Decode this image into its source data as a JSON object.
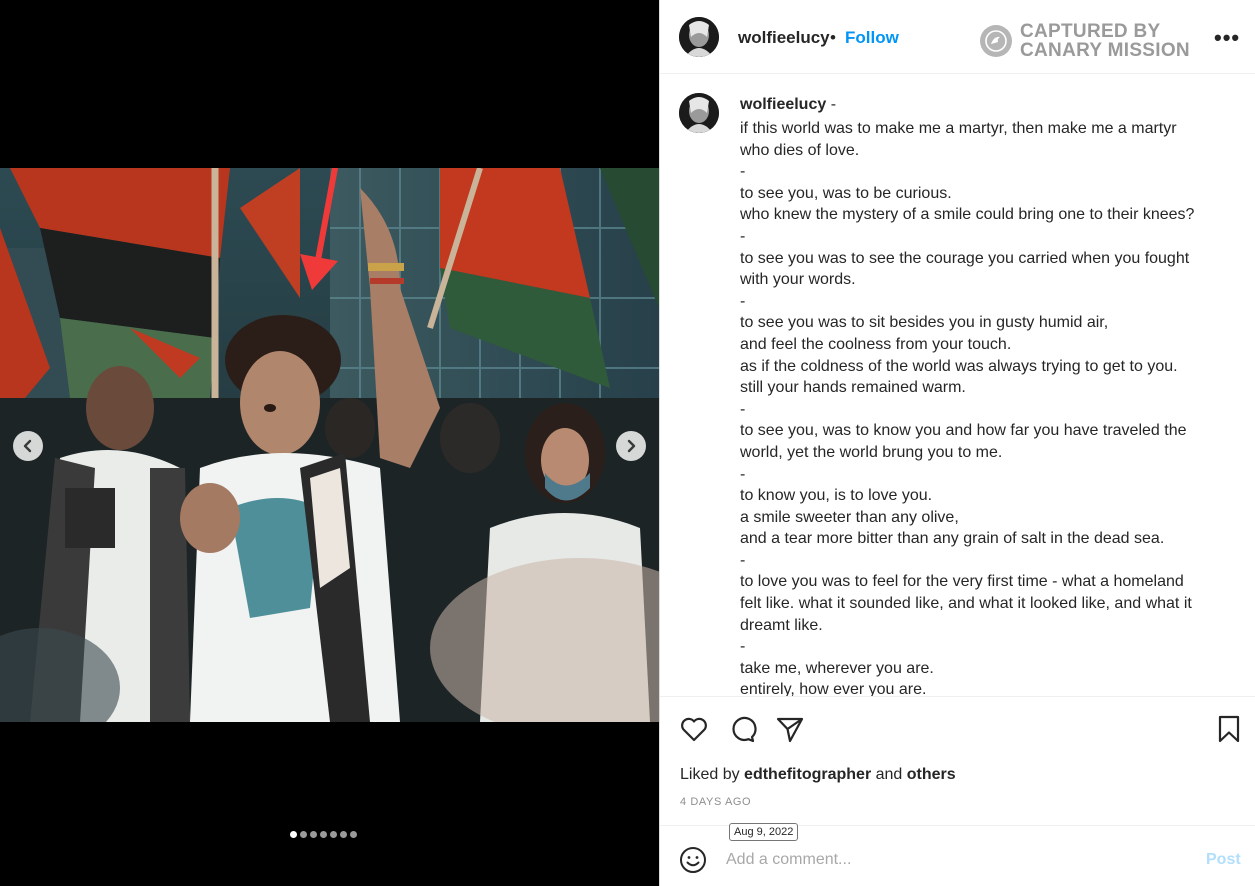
{
  "post": {
    "username": "wolfieelucy",
    "follow_label": "Follow",
    "separator": "•",
    "more_label": "•••"
  },
  "watermark": {
    "line1": "CAPTURED BY",
    "line2": "CANARY MISSION",
    "color": "#9a9a9a"
  },
  "caption": {
    "username": "wolfieelucy",
    "suffix": " -",
    "lines": [
      "if this world was to make me a martyr, then make me a martyr",
      "who dies of love.",
      "-",
      "to see you, was to be curious.",
      "who knew the mystery of a smile could bring one to their knees?",
      "-",
      "to see you was to see the courage you carried when you fought",
      "with your words.",
      "-",
      "to see you was to sit besides you in gusty humid air,",
      "and feel the coolness from your touch.",
      "as if the coldness of the world was always trying to get to you.",
      "still your hands remained warm.",
      "-",
      "to see you, was to know you and how far you have traveled the",
      "world, yet the world brung you to me.",
      "-",
      "to know you, is to love you.",
      "a smile sweeter than any olive,",
      "and a tear more bitter than any grain of salt in the dead sea.",
      "-",
      "to love you was to feel for the very first time - what a homeland",
      "felt like. what it sounded like, and what it looked like, and what it",
      "dreamt like.",
      "-",
      "take me, wherever you are.",
      "entirely, how ever you are."
    ]
  },
  "engagement": {
    "liked_prefix": "Liked by ",
    "liked_user": "edthefitographer",
    "liked_and": " and ",
    "liked_others": "others",
    "time_ago": "4 DAYS AGO",
    "date_tooltip": "Aug 9, 2022"
  },
  "comment": {
    "placeholder": "Add a comment...",
    "post_label": "Post"
  },
  "carousel": {
    "slide_count": 7,
    "active_index": 0
  },
  "icons": {
    "like": "heart-icon",
    "comment": "comment-bubble-icon",
    "share": "paper-plane-icon",
    "save": "bookmark-icon",
    "emoji": "smiley-icon",
    "prev": "chevron-left-icon",
    "next": "chevron-right-icon",
    "annotation": "red-arrow"
  },
  "colors": {
    "link_blue": "#0095f6",
    "post_disabled": "#b2dffc",
    "annotation_red": "#f03a3a"
  }
}
